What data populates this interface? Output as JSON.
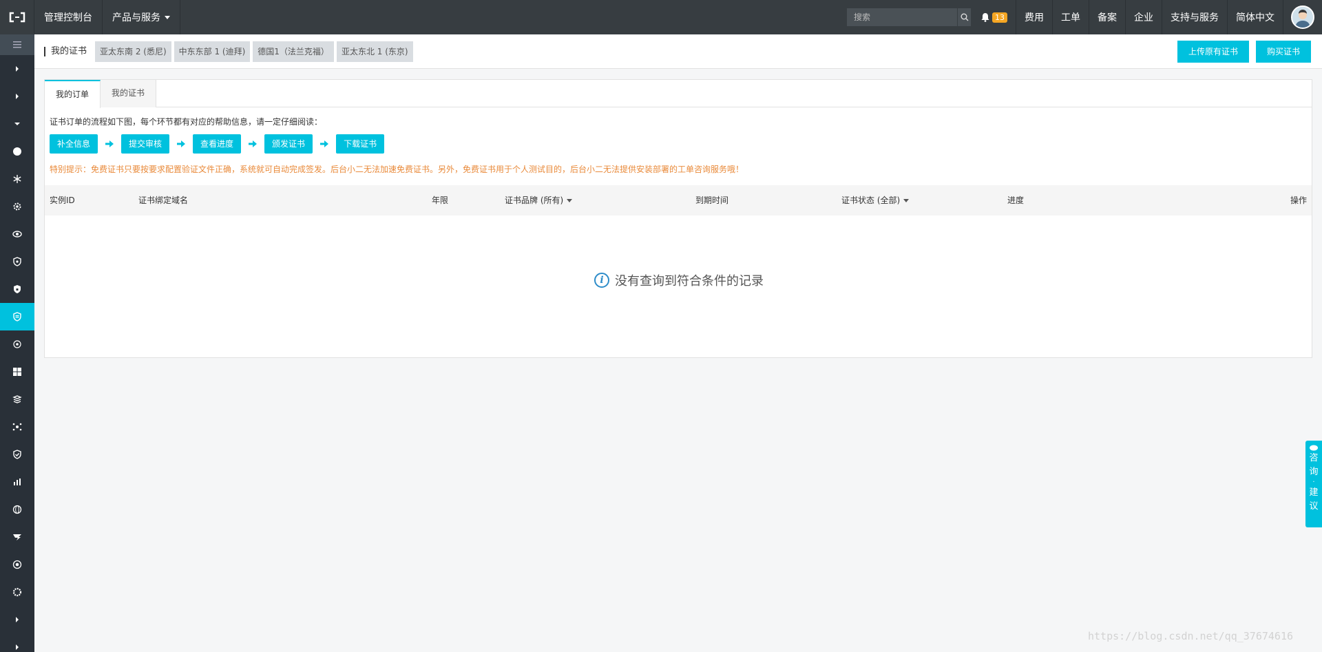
{
  "topbar": {
    "console": "管理控制台",
    "products": "产品与服务",
    "search_placeholder": "搜索",
    "notification_count": "13",
    "nav": [
      "费用",
      "工单",
      "备案",
      "企业",
      "支持与服务",
      "简体中文"
    ]
  },
  "subheader": {
    "title": "我的证书",
    "regions": [
      "亚太东南 2 (悉尼)",
      "中东东部 1 (迪拜)",
      "德国1（法兰克福）",
      "亚太东北 1 (东京)"
    ],
    "upload_btn": "上传原有证书",
    "buy_btn": "购买证书"
  },
  "tabs": [
    "我的订单",
    "我的证书"
  ],
  "intro": "证书订单的流程如下图，每个环节都有对应的帮助信息，请一定仔细阅读：",
  "steps": [
    "补全信息",
    "提交审核",
    "查看进度",
    "颁发证书",
    "下载证书"
  ],
  "notice": "特别提示：免费证书只要按要求配置验证文件正确，系统就可自动完成签发。后台小二无法加速免费证书。另外，免费证书用于个人测试目的，后台小二无法提供安装部署的工单咨询服务哦！",
  "table": {
    "columns": [
      "实例ID",
      "证书绑定域名",
      "年限",
      "证书品牌 (所有)",
      "到期时间",
      "证书状态 (全部)",
      "进度",
      "操作"
    ],
    "empty": "没有查询到符合条件的记录"
  },
  "feedback": [
    "咨",
    "询",
    "·",
    "建",
    "议"
  ],
  "watermark": "https://blog.csdn.net/qq_37674616",
  "colors": {
    "accent": "#00c1de",
    "topbar": "#373d41",
    "sidebar": "#293038",
    "notice": "#e98a3a"
  },
  "sidebar_icons": [
    "menu-icon",
    "chevron-right-icon",
    "chevron-right-icon",
    "chevron-down-icon",
    "circle-icon",
    "snowflake-icon",
    "gear-icon",
    "eye-icon",
    "shield-bug-icon",
    "shield-lock-icon",
    "shield-cert-icon",
    "crosshair-icon",
    "windows-icon",
    "layers-icon",
    "network-icon",
    "shield-check-icon",
    "chart-icon",
    "globe-icon",
    "wing-icon",
    "target-icon",
    "gear-ring-icon",
    "chevron-right-icon",
    "chevron-right-icon"
  ]
}
